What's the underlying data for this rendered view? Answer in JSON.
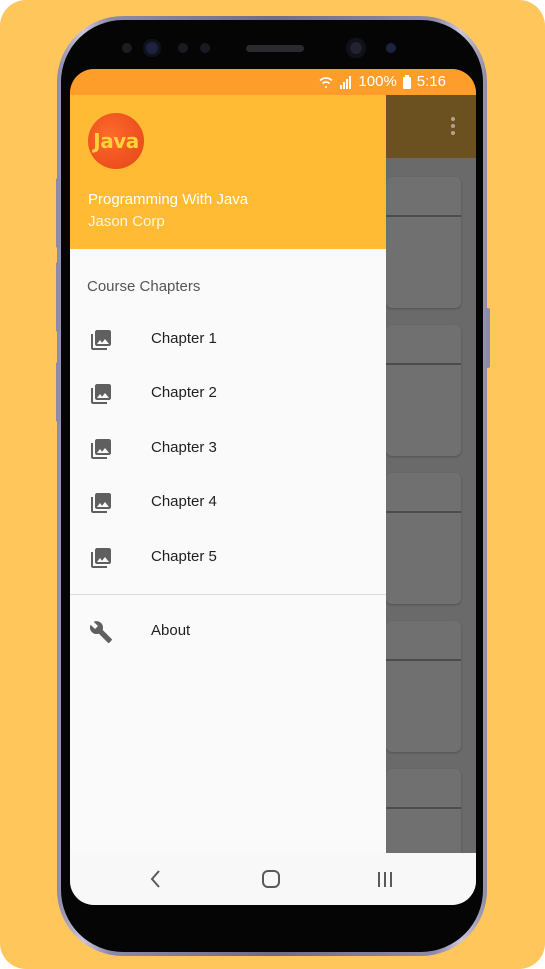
{
  "status_bar": {
    "battery": "100%",
    "time": "5:16",
    "icons": [
      "wifi-icon",
      "signal-icon",
      "battery-icon"
    ]
  },
  "drawer": {
    "header": {
      "logo_text": "Java",
      "title": "Programming With Java",
      "subtitle": "Jason Corp"
    },
    "section_label": "Course Chapters",
    "items": [
      {
        "label": "Chapter 1",
        "icon": "photo-library-icon"
      },
      {
        "label": "Chapter 2",
        "icon": "photo-library-icon"
      },
      {
        "label": "Chapter 3",
        "icon": "photo-library-icon"
      },
      {
        "label": "Chapter 4",
        "icon": "photo-library-icon"
      },
      {
        "label": "Chapter 5",
        "icon": "photo-library-icon"
      }
    ],
    "footer_items": [
      {
        "label": "About",
        "icon": "wrench-icon"
      }
    ]
  },
  "nav_bar": {
    "buttons": [
      "back-icon",
      "home-icon",
      "recents-icon"
    ]
  },
  "colors": {
    "background": "#ffc65c",
    "status_bar": "#ff9d2b",
    "drawer_header": "#ffbb33",
    "scrim": "#6a6a6a"
  }
}
